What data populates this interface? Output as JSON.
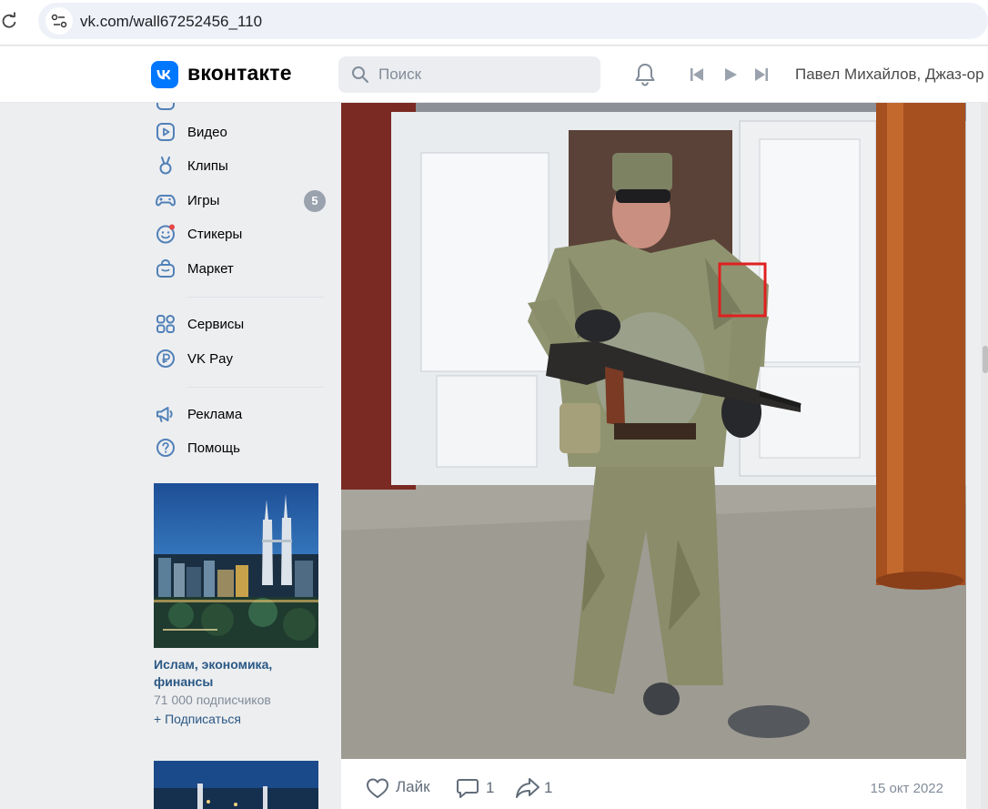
{
  "browser": {
    "url": "vk.com/wall67252456_110"
  },
  "header": {
    "logo_text": "вконтакте",
    "search_placeholder": "Поиск",
    "now_playing": "Павел Михайлов, Джаз-ор"
  },
  "menu": {
    "items": [
      {
        "label": "Видео",
        "icon": "video-icon"
      },
      {
        "label": "Клипы",
        "icon": "clips-icon"
      },
      {
        "label": "Игры",
        "icon": "games-icon",
        "badge": "5"
      },
      {
        "label": "Стикеры",
        "icon": "stickers-icon"
      },
      {
        "label": "Маркет",
        "icon": "market-icon"
      },
      {
        "label": "Сервисы",
        "icon": "services-icon"
      },
      {
        "label": "VK Pay",
        "icon": "vkpay-icon"
      },
      {
        "label": "Реклама",
        "icon": "ads-icon"
      },
      {
        "label": "Помощь",
        "icon": "help-icon"
      }
    ]
  },
  "ad": {
    "title": "Ислам, экономика, финансы",
    "subscribers": "71 000 подписчиков",
    "subscribe_label": "+ Подписаться"
  },
  "post": {
    "like_label": "Лайк",
    "comments": "1",
    "shares": "1",
    "date": "15 окт 2022"
  },
  "colors": {
    "brand": "#0077ff",
    "link": "#2a5885",
    "highlight_box": "#e02020"
  }
}
